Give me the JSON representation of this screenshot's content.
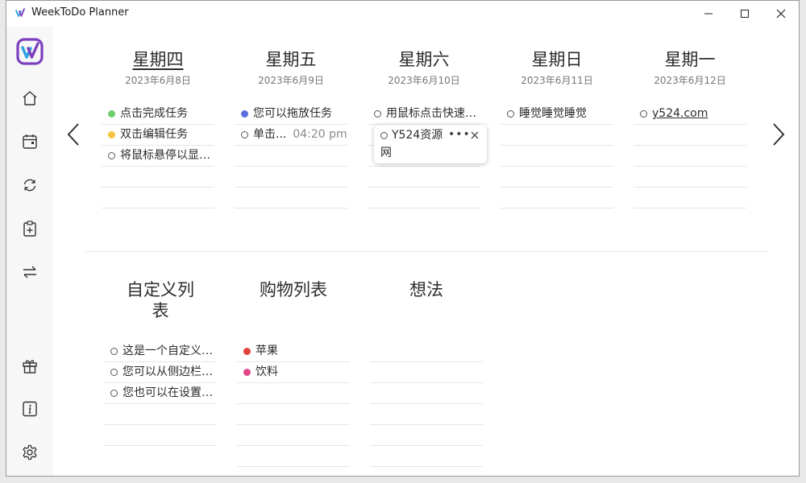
{
  "app": {
    "title": "WeekToDo Planner"
  },
  "colors": {
    "accent": "#7b3fbf",
    "accent2": "#2ba3e0",
    "green": "#6ccf6c",
    "yellow": "#f5c342",
    "blue": "#5b6ee0",
    "red": "#e0443a",
    "pink": "#e2468a"
  },
  "icons": [
    "home-icon",
    "calendar-icon",
    "refresh-icon",
    "clipboard-add-icon",
    "swap-icon",
    "gift-icon",
    "info-icon",
    "gear-icon"
  ],
  "days": [
    {
      "name": "星期四",
      "date": "2023年6月8日",
      "current": true,
      "tasks": [
        {
          "text": "点击完成任务",
          "dot": "#6ccf6c"
        },
        {
          "text": "双击编辑任务",
          "dot": "#f5c342"
        },
        {
          "text": "将鼠标悬停以显示更多",
          "dot": ""
        }
      ]
    },
    {
      "name": "星期五",
      "date": "2023年6月9日",
      "tasks": [
        {
          "text": "您可以拖放任务",
          "dot": "#5b6ee0"
        },
        {
          "text": "单击...",
          "dot": "",
          "time": "04:20 pm"
        }
      ]
    },
    {
      "name": "星期六",
      "date": "2023年6月10日",
      "tasks": [
        {
          "text": "用鼠标点击快速完成",
          "dot": ""
        }
      ]
    },
    {
      "name": "星期日",
      "date": "2023年6月11日",
      "tasks": [
        {
          "text": "睡觉睡觉睡觉",
          "dot": ""
        }
      ]
    },
    {
      "name": "星期一",
      "date": "2023年6月12日",
      "tasks": [
        {
          "text": "y524.com",
          "dot": "",
          "link": true
        }
      ]
    }
  ],
  "popup": {
    "text": "Y524资源网",
    "more": "•••"
  },
  "lists": [
    {
      "name": "自定义列表",
      "tasks": [
        {
          "text": "这是一个自定义列表",
          "dot": ""
        },
        {
          "text": "您可以从侧边栏添加",
          "dot": ""
        },
        {
          "text": "您也可以在设置中更改",
          "dot": ""
        }
      ]
    },
    {
      "name": "购物列表",
      "tasks": [
        {
          "text": "苹果",
          "dot": "#e0443a"
        },
        {
          "text": "饮料",
          "dot": "#e2468a"
        }
      ]
    },
    {
      "name": "想法",
      "tasks": []
    }
  ]
}
